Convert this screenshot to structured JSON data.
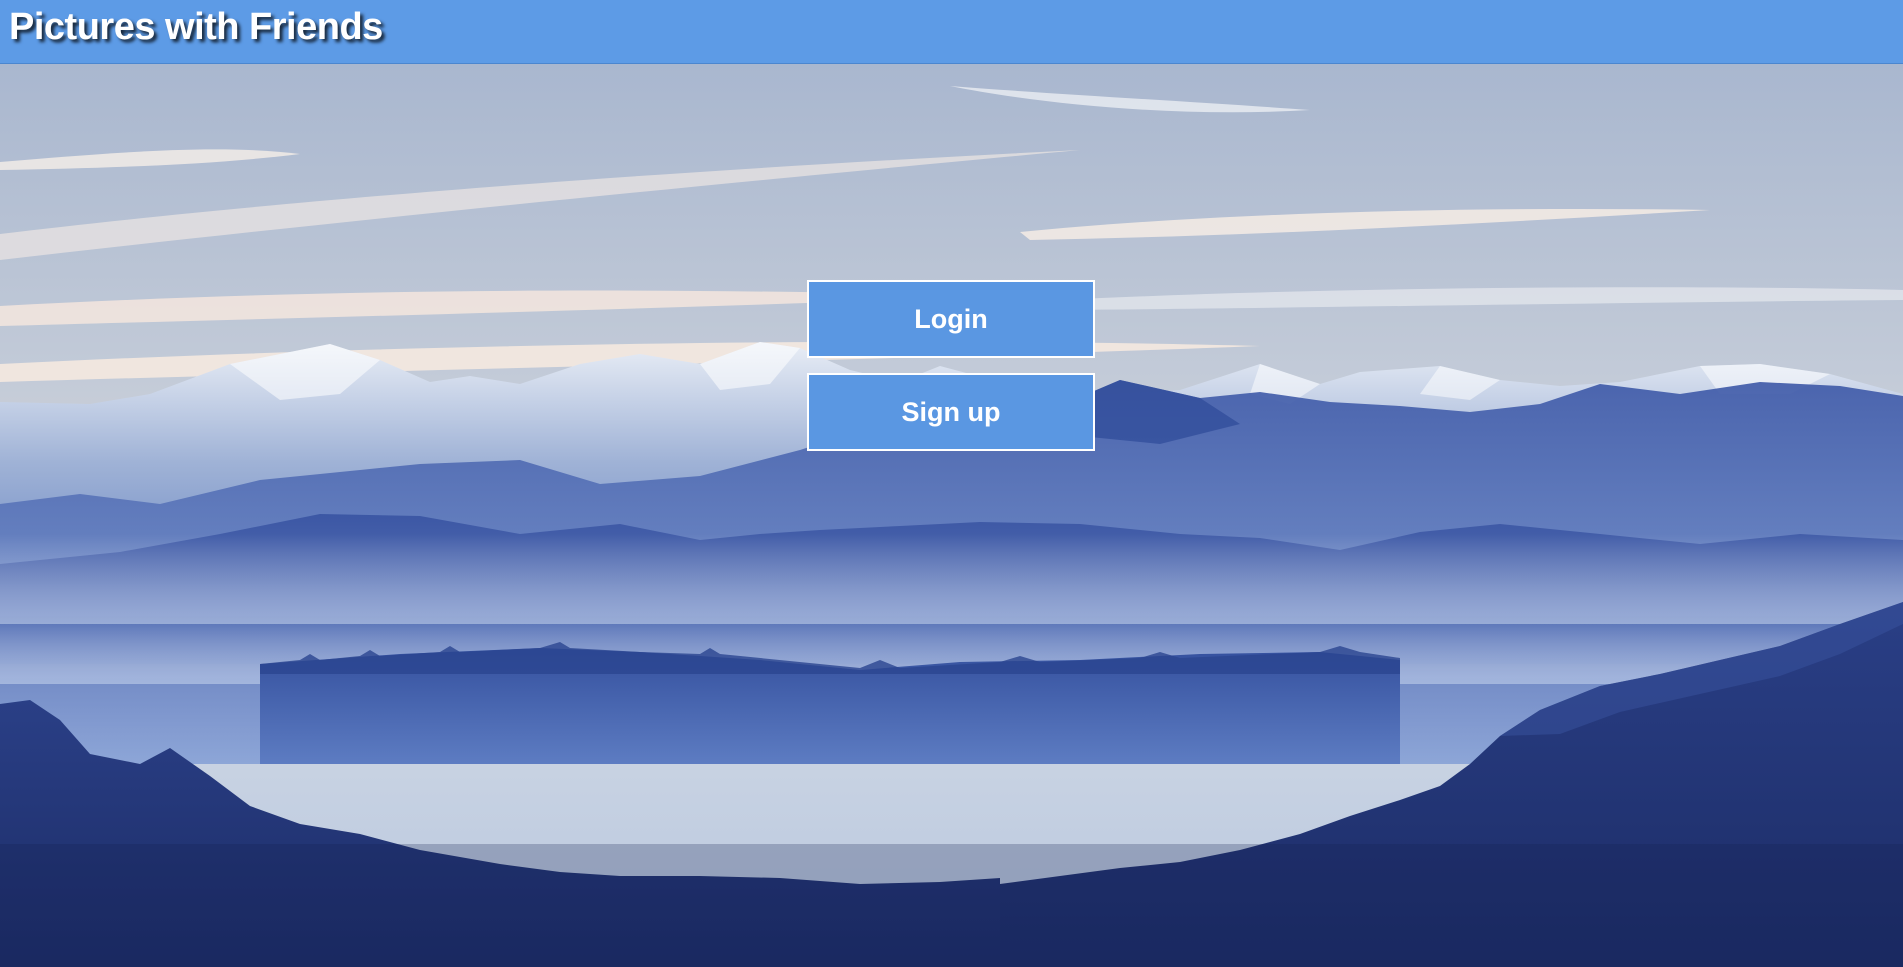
{
  "app": {
    "title": "Pictures with Friends"
  },
  "auth": {
    "login_label": "Login",
    "signup_label": "Sign up"
  },
  "theme": {
    "header_color": "#5d9be6",
    "button_color": "#5a97e2",
    "button_border": "#ffffff",
    "text_color": "#ffffff"
  },
  "background": {
    "description_icon": "mountain-landscape-image"
  }
}
